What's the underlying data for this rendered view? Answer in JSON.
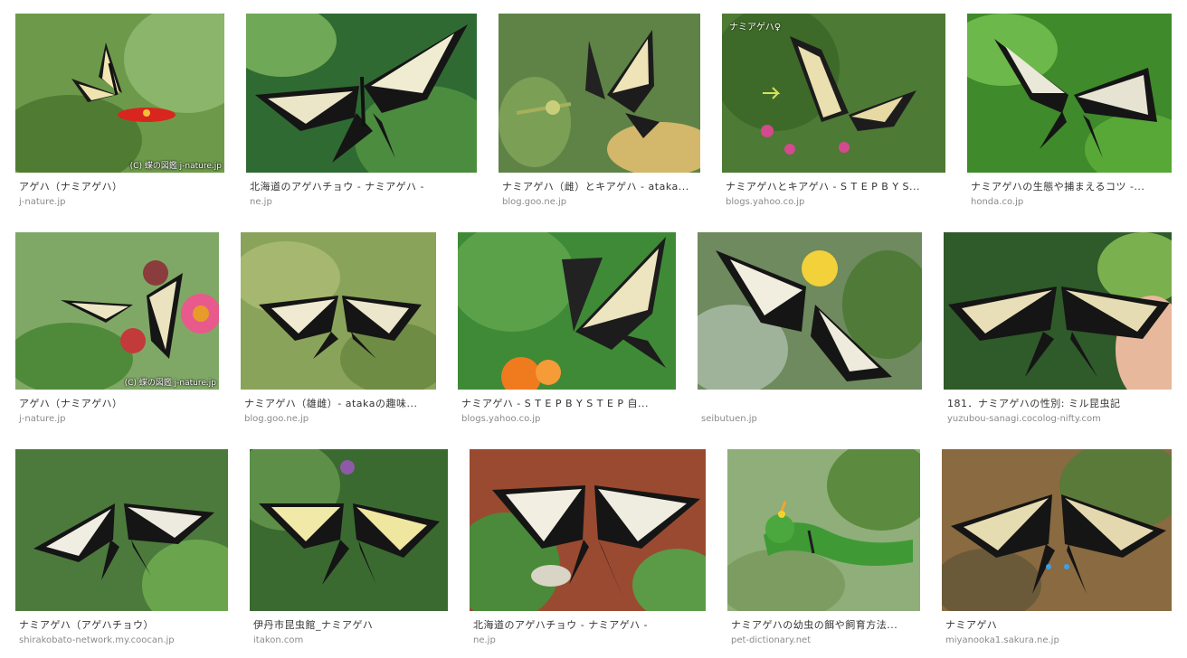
{
  "results": [
    {
      "caption": "アゲハ（ナミアゲハ）",
      "source": "j-nature.jp",
      "watermark": "(C) 蝶の図鑑 j-nature.jp",
      "overlay": ""
    },
    {
      "caption": "北海道のアゲハチョウ - ナミアゲハ -",
      "source": "ne.jp",
      "watermark": "",
      "overlay": ""
    },
    {
      "caption": "ナミアゲハ（雌）とキアゲハ - ataka...",
      "source": "blog.goo.ne.jp",
      "watermark": "",
      "overlay": ""
    },
    {
      "caption": "ナミアゲハとキアゲハ - S T E P  B Y  S...",
      "source": "blogs.yahoo.co.jp",
      "watermark": "",
      "overlay": "ナミアゲハ♀"
    },
    {
      "caption": "ナミアゲハの生態や捕まえるコツ -...",
      "source": "honda.co.jp",
      "watermark": "",
      "overlay": ""
    },
    {
      "caption": "アゲハ（ナミアゲハ）",
      "source": "j-nature.jp",
      "watermark": "(C) 蝶の図鑑 j-nature.jp",
      "overlay": ""
    },
    {
      "caption": "ナミアゲハ（雄雌）- atakaの趣味...",
      "source": "blog.goo.ne.jp",
      "watermark": "",
      "overlay": ""
    },
    {
      "caption": "ナミアゲハ - S T E P  B Y  S T E P 自...",
      "source": "blogs.yahoo.co.jp",
      "watermark": "",
      "overlay": ""
    },
    {
      "caption": "",
      "source": "seibutuen.jp",
      "watermark": "",
      "overlay": ""
    },
    {
      "caption": "181．ナミアゲハの性別: ミル昆虫記",
      "source": "yuzubou-sanagi.cocolog-nifty.com",
      "watermark": "",
      "overlay": ""
    },
    {
      "caption": "ナミアゲハ（アゲハチョウ）",
      "source": "shirakobato-network.my.coocan.jp",
      "watermark": "",
      "overlay": ""
    },
    {
      "caption": "伊丹市昆虫館_ナミアゲハ",
      "source": "itakon.com",
      "watermark": "",
      "overlay": ""
    },
    {
      "caption": "北海道のアゲハチョウ - ナミアゲハ -",
      "source": "ne.jp",
      "watermark": "",
      "overlay": ""
    },
    {
      "caption": "ナミアゲハの幼虫の餌や飼育方法...",
      "source": "pet-dictionary.net",
      "watermark": "",
      "overlay": ""
    },
    {
      "caption": "ナミアゲハ",
      "source": "miyanooka1.sakura.ne.jp",
      "watermark": "",
      "overlay": ""
    }
  ],
  "colors": {
    "caption_text": "#333333",
    "source_text": "#8a8a8a",
    "background": "#ffffff"
  }
}
